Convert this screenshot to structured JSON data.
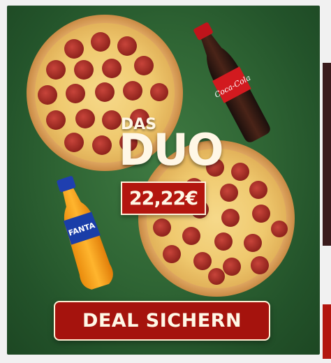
{
  "promo": {
    "headline_small": "DAS",
    "headline_large": "DUO",
    "price": "22,22€",
    "cta_label": "DEAL SICHERN"
  },
  "products": {
    "coke_brand": "Coca-Cola",
    "fanta_brand": "FANTA"
  },
  "colors": {
    "background_green": "#2f6534",
    "accent_red": "#b3160f",
    "cream_text": "#fff7e6"
  }
}
